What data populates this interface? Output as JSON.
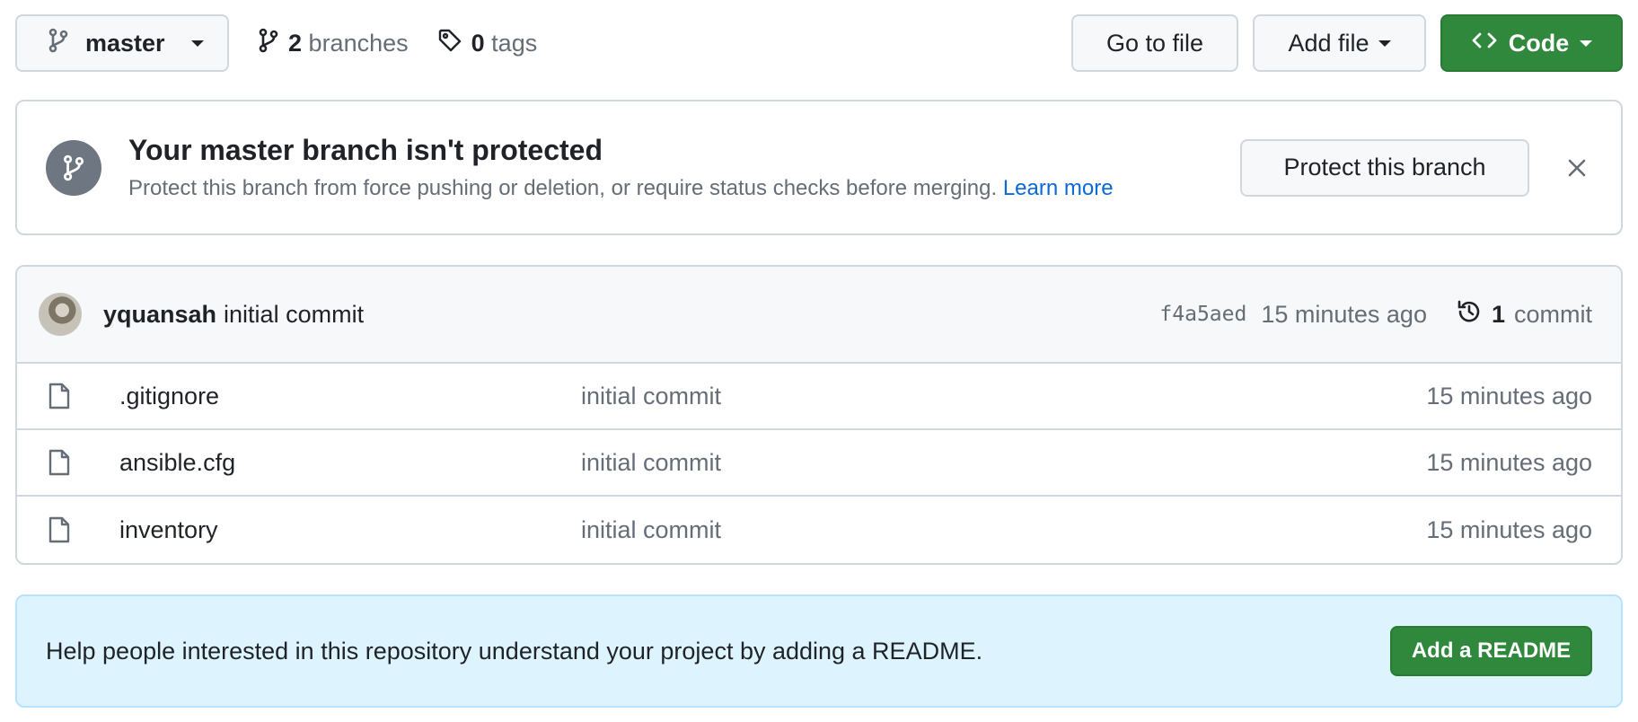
{
  "toolbar": {
    "branch_name": "master",
    "branches_count": "2",
    "branches_label": "branches",
    "tags_count": "0",
    "tags_label": "tags",
    "go_to_file_label": "Go to file",
    "add_file_label": "Add file",
    "code_label": "Code"
  },
  "protect_banner": {
    "title": "Your master branch isn't protected",
    "description": "Protect this branch from force pushing or deletion, or require status checks before merging.",
    "learn_more": "Learn more",
    "button_label": "Protect this branch"
  },
  "latest_commit": {
    "author": "yquansah",
    "message": "initial commit",
    "sha": "f4a5aed",
    "time": "15 minutes ago",
    "commit_count": "1",
    "commit_label": "commit"
  },
  "files": [
    {
      "name": ".gitignore",
      "commit": "initial commit",
      "time": "15 minutes ago"
    },
    {
      "name": "ansible.cfg",
      "commit": "initial commit",
      "time": "15 minutes ago"
    },
    {
      "name": "inventory",
      "commit": "initial commit",
      "time": "15 minutes ago"
    }
  ],
  "readme_banner": {
    "text": "Help people interested in this repository understand your project by adding a README.",
    "button_label": "Add a README"
  },
  "colors": {
    "accent_green": "#2f883c",
    "link_blue": "#0969da",
    "readme_bg": "#ddf4ff"
  }
}
